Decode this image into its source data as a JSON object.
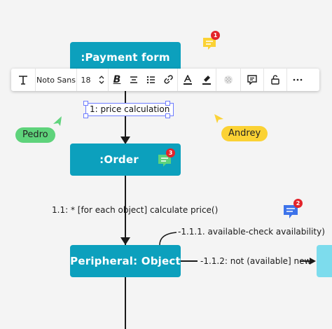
{
  "toolbar": {
    "font_family": "Noto Sans",
    "font_size": "18"
  },
  "nodes": {
    "payment_form": ":Payment form",
    "order": ":Order",
    "peripheral": "Peripheral: Object"
  },
  "messages": {
    "price_calculation": "1: price calculation",
    "calculate_price": "1.1: * [for each object] calculate price()",
    "check_availability": "-1.1.1. available-check availability)",
    "not_available_new": "-1.1.2: not (available] new"
  },
  "collaborators": {
    "pedro": {
      "name": "Pedro",
      "color": "#5ed37b"
    },
    "andrey": {
      "name": "Andrey",
      "color": "#fbd234"
    }
  },
  "comments": {
    "top_badge": "1",
    "order_badge": "3",
    "right_badge": "2"
  },
  "colors": {
    "node_fill": "#0ca0bd",
    "partial_node_fill": "#7ddced",
    "selection": "#6d7cff",
    "badge": "#e3242b"
  }
}
